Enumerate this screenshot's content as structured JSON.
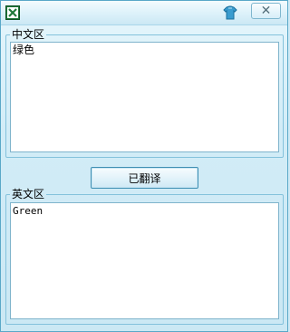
{
  "window": {
    "app_icon": "excel-icon",
    "skin_icon": "shirt-icon",
    "close_label": "✕"
  },
  "chinese_section": {
    "legend": "中文区",
    "text": "绿色"
  },
  "translate_button": {
    "label": "已翻译"
  },
  "english_section": {
    "legend": "英文区",
    "text": "Green"
  }
}
